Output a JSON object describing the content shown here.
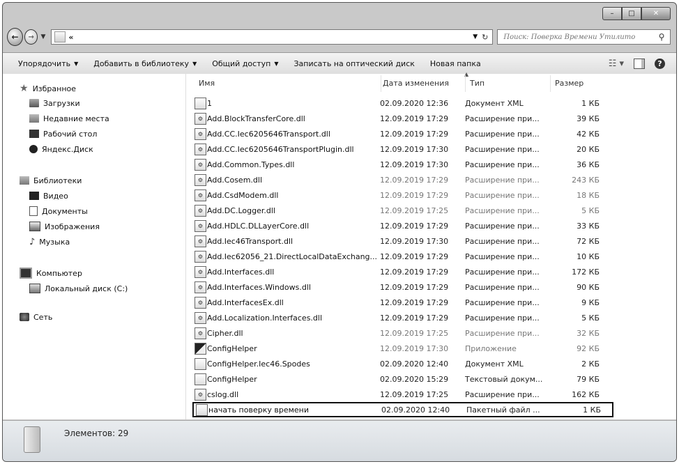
{
  "window": {
    "title_buttons": {
      "minimize": "–",
      "maximize": "□",
      "close": "✕"
    }
  },
  "nav": {
    "back": "←",
    "forward": "→",
    "breadcrumb": "«",
    "search_placeholder": "Поиск: Поверка Времени Утилито"
  },
  "toolbar": {
    "items": [
      {
        "label": "Упорядочить",
        "arrow": "▼"
      },
      {
        "label": "Добавить в библиотеку",
        "arrow": "▼"
      },
      {
        "label": "Общий доступ",
        "arrow": "▼"
      },
      {
        "label": "Записать на оптический диск",
        "arrow": ""
      },
      {
        "label": "Новая папка",
        "arrow": ""
      }
    ]
  },
  "sidebar": {
    "favorites": {
      "label": "Избранное",
      "items": [
        "Загрузки",
        "Недавние места",
        "Рабочий стол",
        "Яндекс.Диск"
      ]
    },
    "libraries": {
      "label": "Библиотеки",
      "items": [
        "Видео",
        "Документы",
        "Изображения",
        "Музыка"
      ]
    },
    "computer": {
      "label": "Компьютер",
      "items": [
        "Локальный диск (C:)"
      ]
    },
    "network": {
      "label": "Сеть"
    }
  },
  "columns": {
    "name": "Имя",
    "date": "Дата изменения",
    "type": "Тип",
    "size": "Размер"
  },
  "files": [
    {
      "name": "1",
      "date": "02.09.2020 12:36",
      "type": "Документ XML",
      "size": "1 КБ",
      "icon": "xml-file-icon"
    },
    {
      "name": "Add.BlockTransferCore.dll",
      "date": "12.09.2019 17:29",
      "type": "Расширение при...",
      "size": "39 КБ",
      "icon": "dll-file-icon"
    },
    {
      "name": "Add.CC.Iec6205646Transport.dll",
      "date": "12.09.2019 17:29",
      "type": "Расширение при...",
      "size": "42 КБ",
      "icon": "dll-file-icon"
    },
    {
      "name": "Add.CC.Iec6205646TransportPlugin.dll",
      "date": "12.09.2019 17:30",
      "type": "Расширение при...",
      "size": "20 КБ",
      "icon": "dll-file-icon"
    },
    {
      "name": "Add.Common.Types.dll",
      "date": "12.09.2019 17:30",
      "type": "Расширение при...",
      "size": "36 КБ",
      "icon": "dll-file-icon"
    },
    {
      "name": "Add.Cosem.dll",
      "date": "12.09.2019 17:29",
      "type": "Расширение при...",
      "size": "243 КБ",
      "icon": "dll-file-icon"
    },
    {
      "name": "Add.CsdModem.dll",
      "date": "12.09.2019 17:29",
      "type": "Расширение при...",
      "size": "18 КБ",
      "icon": "dll-file-icon"
    },
    {
      "name": "Add.DC.Logger.dll",
      "date": "12.09.2019 17:25",
      "type": "Расширение при...",
      "size": "5 КБ",
      "icon": "dll-file-icon"
    },
    {
      "name": "Add.HDLC.DLLayerCore.dll",
      "date": "12.09.2019 17:29",
      "type": "Расширение при...",
      "size": "33 КБ",
      "icon": "dll-file-icon"
    },
    {
      "name": "Add.Iec46Transport.dll",
      "date": "12.09.2019 17:30",
      "type": "Расширение при...",
      "size": "72 КБ",
      "icon": "dll-file-icon"
    },
    {
      "name": "Add.Iec62056_21.DirectLocalDataExchang...",
      "date": "12.09.2019 17:29",
      "type": "Расширение при...",
      "size": "10 КБ",
      "icon": "dll-file-icon"
    },
    {
      "name": "Add.Interfaces.dll",
      "date": "12.09.2019 17:29",
      "type": "Расширение при...",
      "size": "172 КБ",
      "icon": "dll-file-icon"
    },
    {
      "name": "Add.Interfaces.Windows.dll",
      "date": "12.09.2019 17:29",
      "type": "Расширение при...",
      "size": "90 КБ",
      "icon": "dll-file-icon"
    },
    {
      "name": "Add.InterfacesEx.dll",
      "date": "12.09.2019 17:29",
      "type": "Расширение при...",
      "size": "9 КБ",
      "icon": "dll-file-icon"
    },
    {
      "name": "Add.Localization.Interfaces.dll",
      "date": "12.09.2019 17:29",
      "type": "Расширение при...",
      "size": "5 КБ",
      "icon": "dll-file-icon"
    },
    {
      "name": "Cipher.dll",
      "date": "12.09.2019 17:25",
      "type": "Расширение при...",
      "size": "32 КБ",
      "icon": "dll-file-icon"
    },
    {
      "name": "ConfigHelper",
      "date": "12.09.2019 17:30",
      "type": "Приложение",
      "size": "92 КБ",
      "icon": "app-icon"
    },
    {
      "name": "ConfigHelper.Iec46.Spodes",
      "date": "02.09.2020 12:40",
      "type": "Документ XML",
      "size": "2 КБ",
      "icon": "xml-file-icon"
    },
    {
      "name": "ConfigHelper",
      "date": "02.09.2020 15:29",
      "type": "Текстовый докум...",
      "size": "79 КБ",
      "icon": "text-file-icon"
    },
    {
      "name": "cslog.dll",
      "date": "12.09.2019 17:25",
      "type": "Расширение при...",
      "size": "162 КБ",
      "icon": "dll-file-icon"
    },
    {
      "name": "начать поверку времени",
      "date": "02.09.2020 12:40",
      "type": "Пакетный файл ...",
      "size": "1 КБ",
      "icon": "batch-file-icon"
    }
  ],
  "status": {
    "text": "Элементов: 29"
  }
}
